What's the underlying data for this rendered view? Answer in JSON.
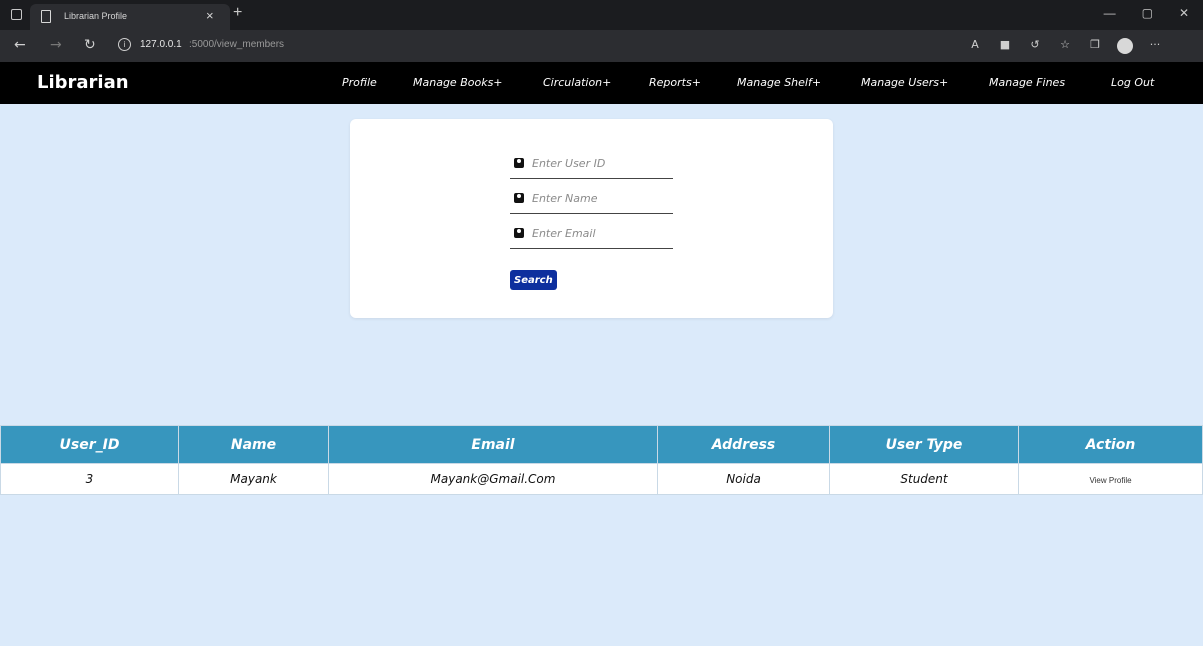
{
  "browser": {
    "tab_title": "Librarian Profile",
    "tab_close": "×",
    "new_tab": "+",
    "url_host": "127.0.0.1",
    "url_path": ":5000/view_members"
  },
  "navbar": {
    "brand": "Librarian",
    "items": [
      "Profile",
      "Manage Books+",
      "Circulation+",
      "Reports+",
      "Manage Shelf+",
      "Manage Users+",
      "Manage Fines",
      "Log Out"
    ]
  },
  "search": {
    "user_id_placeholder": "Enter User ID",
    "name_placeholder": "Enter Name",
    "email_placeholder": "Enter Email",
    "button_label": "Search"
  },
  "table": {
    "headers": [
      "User_ID",
      "Name",
      "Email",
      "Address",
      "User Type",
      "Action"
    ],
    "rows": [
      {
        "user_id": "3",
        "name": "Mayank",
        "email": "Mayank@Gmail.Com",
        "address": "Noida",
        "user_type": "Student",
        "action": "View Profile"
      }
    ]
  },
  "colors": {
    "page_bg": "#dbeafa",
    "navbar_bg": "#000000",
    "table_header_bg": "#3796be",
    "search_button_bg": "#0d2f9e"
  }
}
